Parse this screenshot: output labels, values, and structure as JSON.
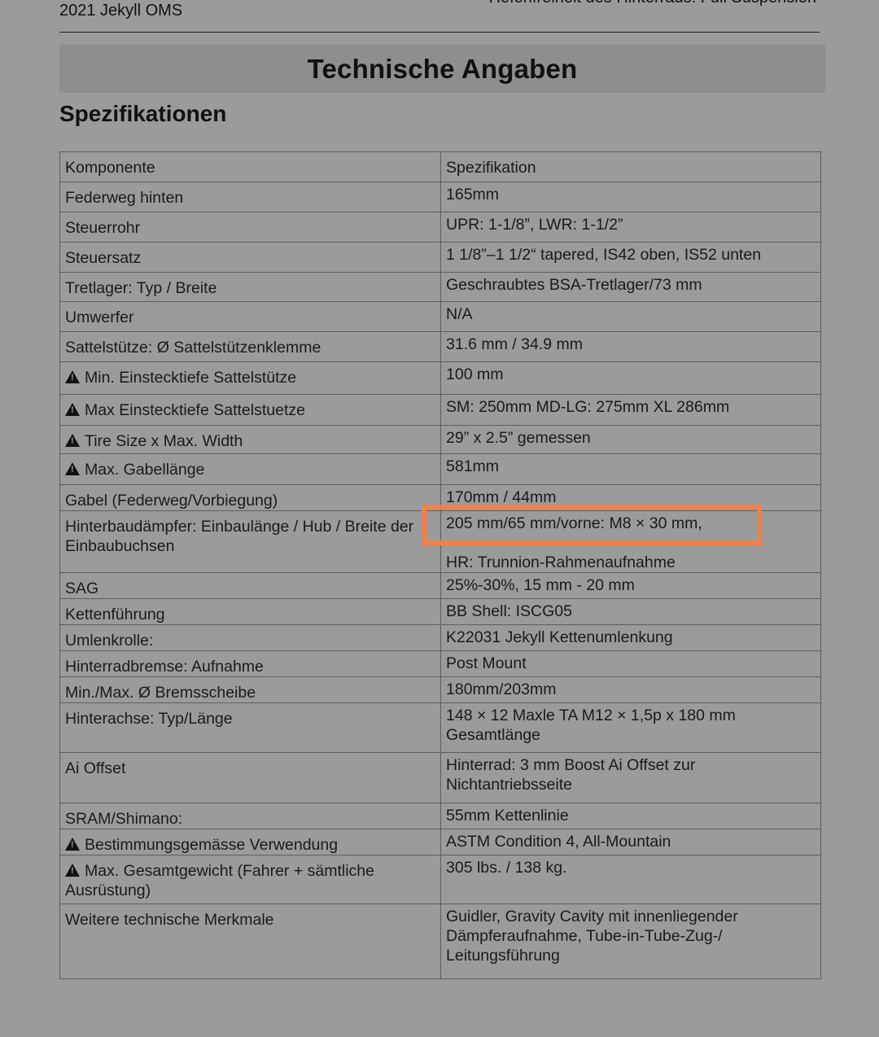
{
  "header": {
    "left": "2021 Jekyll OMS",
    "right": "Hefenfreiheit des Hinterrads: Full Suspension"
  },
  "title": "Technische Angaben",
  "subtitle": "Spezifikationen",
  "table": {
    "head": [
      "Komponente",
      "Spezifikation"
    ],
    "rows": [
      {
        "label": "Federweg hinten",
        "warn": false,
        "value": [
          "165mm"
        ]
      },
      {
        "label": "Steuerrohr",
        "warn": false,
        "value": [
          "UPR: 1-1/8”, LWR: 1-1/2”"
        ]
      },
      {
        "label": "Steuersatz",
        "warn": false,
        "value": [
          "1 1/8”–1 1/2“ tapered, IS42 oben, IS52 unten"
        ]
      },
      {
        "label": "Tretlager: Typ / Breite",
        "warn": false,
        "value": [
          "Geschraubtes BSA-Tretlager/73 mm"
        ]
      },
      {
        "label": "Umwerfer",
        "warn": false,
        "value": [
          "N/A"
        ]
      },
      {
        "label": "Sattelstütze: Ø Sattelstützenklemme",
        "warn": false,
        "value": [
          "31.6 mm / 34.9 mm"
        ]
      },
      {
        "label": "Min. Einstecktiefe Sattelstütze",
        "warn": true,
        "value": [
          "100 mm"
        ]
      },
      {
        "label": "Max Einstecktiefe Sattelstuetze",
        "warn": true,
        "value": [
          "SM: 250mm MD-LG: 275mm XL 286mm"
        ]
      },
      {
        "label": "Tire Size x Max. Width",
        "warn": true,
        "value": [
          "29” x 2.5” gemessen"
        ]
      },
      {
        "label": "Max. Gabellänge",
        "warn": true,
        "value": [
          "581mm"
        ]
      },
      {
        "label": "Gabel (Federweg/Vorbiegung)",
        "warn": false,
        "value": [
          "170mm / 44mm"
        ]
      },
      {
        "label": "Hinterbaudämpfer: Einbaulänge / Hub / Breite der Einbaubuchsen",
        "warn": false,
        "value": [
          "205 mm/65 mm/vorne: M8 × 30 mm,",
          "",
          "HR: Trunnion-Rahmenaufnahme"
        ]
      },
      {
        "label": "SAG",
        "warn": false,
        "value": [
          "25%-30%, 15 mm - 20 mm"
        ]
      },
      {
        "label": "Kettenführung",
        "warn": false,
        "value": [
          "BB Shell: ISCG05"
        ]
      },
      {
        "label": "Umlenkrolle:",
        "warn": false,
        "value": [
          "K22031 Jekyll Kettenumlenkung"
        ]
      },
      {
        "label": "Hinterradbremse: Aufnahme",
        "warn": false,
        "value": [
          "Post Mount"
        ]
      },
      {
        "label": "Min./Max. Ø Bremsscheibe",
        "warn": false,
        "value": [
          "180mm/203mm"
        ]
      },
      {
        "label": "Hinterachse: Typ/Länge",
        "warn": false,
        "value": [
          "148 × 12 Maxle TA M12 × 1,5p x 180 mm",
          "Gesamtlänge"
        ]
      },
      {
        "label": "Ai Offset",
        "warn": false,
        "value": [
          "Hinterrad: 3 mm Boost Ai Offset zur",
          "Nichtantriebsseite"
        ]
      },
      {
        "label": "SRAM/Shimano:",
        "warn": false,
        "value": [
          "55mm Kettenlinie"
        ]
      },
      {
        "label": "Bestimmungsgemässe Verwendung",
        "warn": true,
        "value": [
          "ASTM Condition 4, All-Mountain"
        ]
      },
      {
        "label": "Max. Gesamtgewicht (Fahrer + sämtliche Ausrüstung)",
        "warn": true,
        "value": [
          "305 lbs. / 138 kg."
        ]
      },
      {
        "label": "Weitere technische Merkmale",
        "warn": false,
        "value": [
          "Guidler, Gravity Cavity mit innenliegender",
          "Dämpferaufnahme, Tube-in-Tube-Zug-/",
          "Leitungsführung"
        ]
      }
    ]
  },
  "highlight_color": "#f2804a"
}
